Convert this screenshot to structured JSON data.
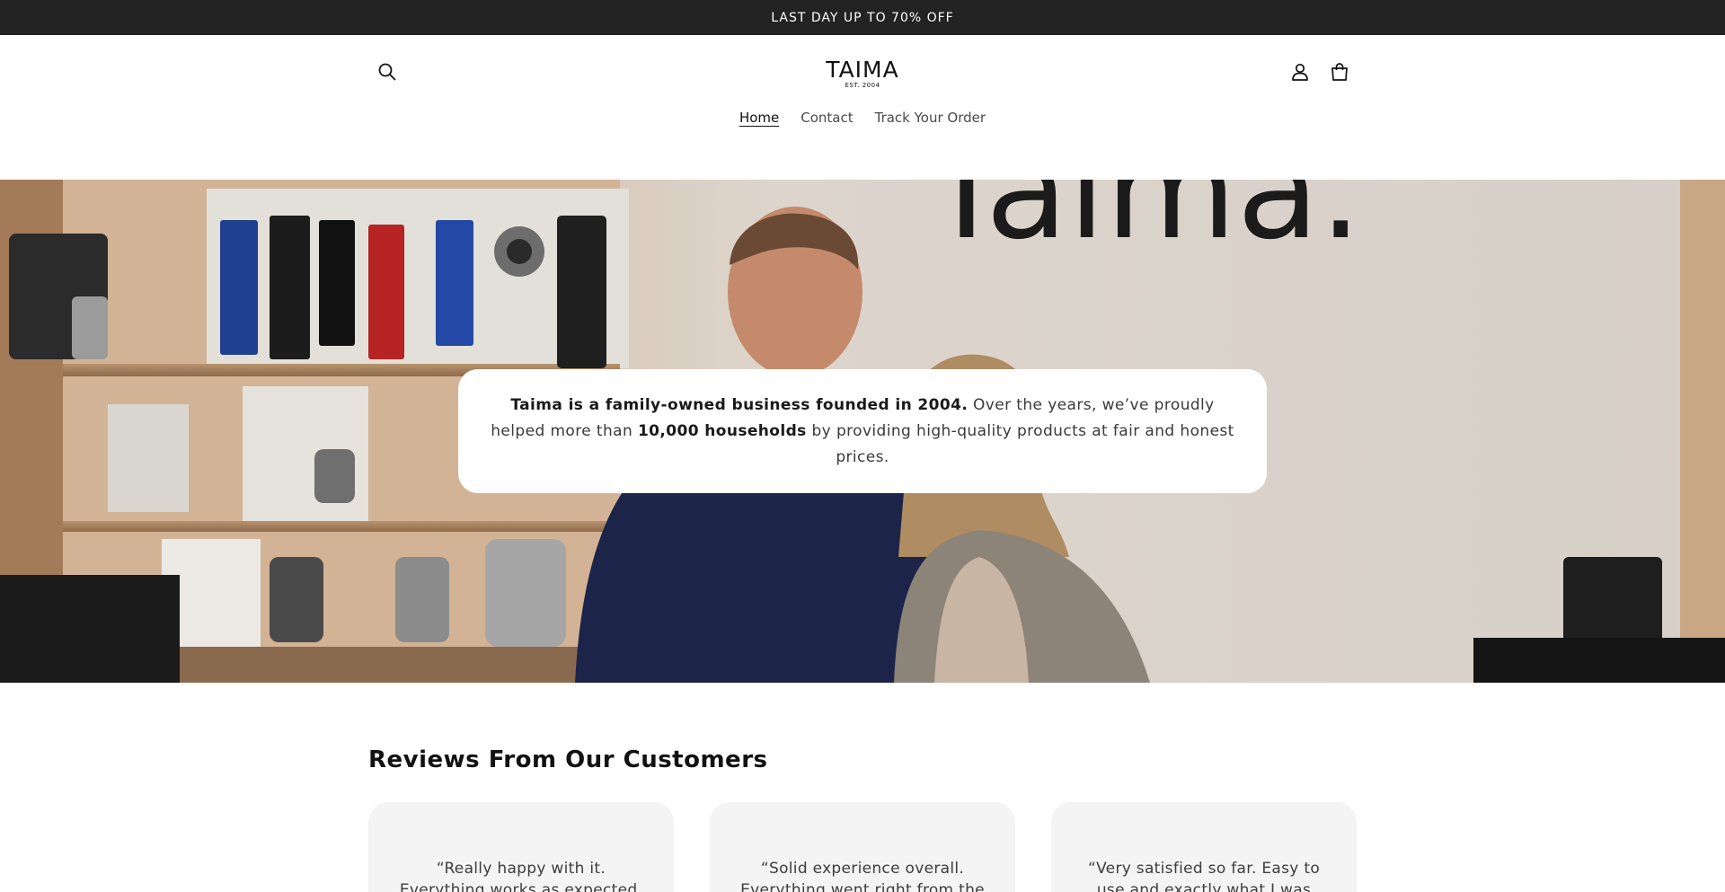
{
  "announcement": {
    "text": "LAST DAY UP TO 70% OFF"
  },
  "header": {
    "logo": {
      "name": "TAIMA",
      "est": "EST. 2004"
    },
    "icons": {
      "search": "search-icon",
      "account": "user-icon",
      "cart": "cart-icon"
    }
  },
  "nav": {
    "items": [
      {
        "label": "Home",
        "active": true
      },
      {
        "label": "Contact",
        "active": false
      },
      {
        "label": "Track Your Order",
        "active": false
      }
    ]
  },
  "hero": {
    "wall_text": "Taima.",
    "intro": {
      "bold_1": "Taima is a family-owned business founded in 2004.",
      "text_1": " Over the years, we’ve proudly helped more than ",
      "bold_2": "10,000 households",
      "text_2": " by providing high-quality products at fair and honest prices."
    }
  },
  "reviews": {
    "title": "Reviews From Our Customers",
    "items": [
      {
        "text": "“Really happy with it. Everything works as expected. Would"
      },
      {
        "text": "“Solid experience overall. Everything went right from the"
      },
      {
        "text": "“Very satisfied so far. Easy to use and exactly what I was looking"
      }
    ]
  },
  "colors": {
    "announcement_bg": "#232323",
    "card_bg": "#f4f4f4",
    "text": "#121212"
  }
}
